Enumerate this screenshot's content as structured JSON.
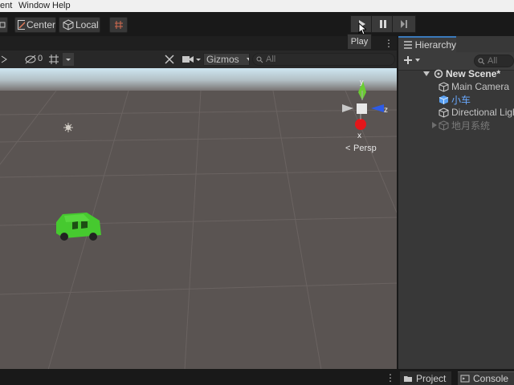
{
  "menubar": {
    "items": [
      "ent",
      "Window",
      "Help"
    ]
  },
  "toolbar": {
    "center_label": "Center",
    "local_label": "Local",
    "play_tooltip": "Play"
  },
  "scene_toolbar": {
    "hidden_count": "0",
    "gizmos_label": "Gizmos",
    "search_placeholder": "All"
  },
  "scene_view": {
    "orientation_axis_x": "x",
    "orientation_axis_z": "z",
    "orientation_axis_y": "y",
    "projection_label": "Persp",
    "colors": {
      "ground": "#5a5452",
      "sky": "#cfe6f1",
      "car": "#46c92f"
    }
  },
  "hierarchy": {
    "tab_label": "Hierarchy",
    "search_placeholder": "All",
    "scene_name": "New Scene*",
    "items": [
      {
        "label": "Main Camera",
        "icon": "cube-outline-icon",
        "color": "#c4c4c4"
      },
      {
        "label": "小车",
        "icon": "prefab-cube-icon",
        "color": "#69a9ff"
      },
      {
        "label": "Directional Light",
        "icon": "cube-outline-icon",
        "color": "#c4c4c4"
      },
      {
        "label": "地月系统",
        "icon": "cube-outline-icon",
        "color": "#7a7a7a"
      }
    ]
  },
  "bottom_tabs": {
    "project_label": "Project",
    "console_label": "Console"
  }
}
